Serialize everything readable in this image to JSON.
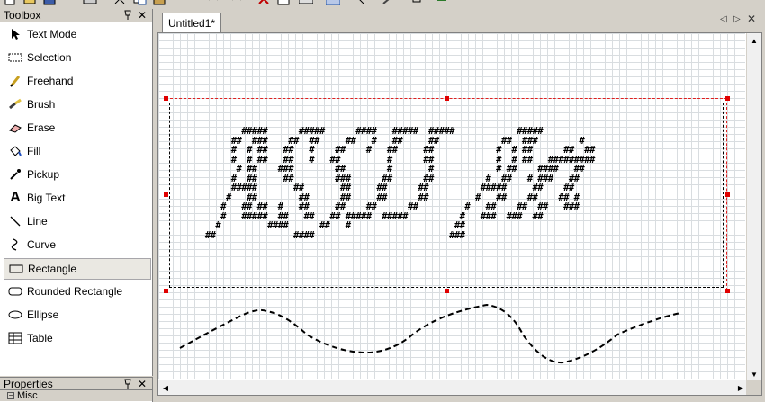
{
  "toolbar": {
    "icons": [
      "new-icon",
      "open-icon",
      "save-icon",
      "print-icon",
      "cut-icon",
      "copy-icon",
      "paste-icon",
      "undo-icon",
      "redo-icon",
      "delete-icon",
      "clipboard-icon",
      "keyboard-icon",
      "grid-icon",
      "pointer-icon",
      "wand-icon",
      "exit-icon"
    ]
  },
  "toolbox": {
    "title": "Toolbox",
    "pin_glyph": "📌",
    "close_glyph": "✕",
    "items": [
      {
        "label": "Text Mode",
        "icon": "arrow-cursor-icon"
      },
      {
        "label": "Selection",
        "icon": "selection-icon"
      },
      {
        "label": "Freehand",
        "icon": "pencil-icon"
      },
      {
        "label": "Brush",
        "icon": "brush-icon"
      },
      {
        "label": "Erase",
        "icon": "eraser-icon"
      },
      {
        "label": "Fill",
        "icon": "fill-bucket-icon"
      },
      {
        "label": "Pickup",
        "icon": "eyedropper-icon"
      },
      {
        "label": "Big Text",
        "icon": "big-a-icon"
      },
      {
        "label": "Line",
        "icon": "line-icon"
      },
      {
        "label": "Curve",
        "icon": "curve-icon"
      },
      {
        "label": "Rectangle",
        "icon": "rectangle-icon"
      },
      {
        "label": "Rounded Rectangle",
        "icon": "rounded-rectangle-icon"
      },
      {
        "label": "Ellipse",
        "icon": "ellipse-icon"
      },
      {
        "label": "Table",
        "icon": "table-icon"
      }
    ],
    "selected": "Rectangle"
  },
  "properties": {
    "title": "Properties",
    "misc_label": "Misc",
    "misc_toggle": "−"
  },
  "document": {
    "tab_label": "Untitled1*",
    "nav_prev": "◁",
    "nav_next": "▷",
    "nav_close": "✕",
    "ascii_lines": [
      "            #####      #####      ####   #####  #####            #####",
      "          ##  ###    ##  ##     ##   #   ##     ##            ##  ###        #",
      "          #  # ##   ##   #    ##    #   ##     ##            #  # ##      ##  ##",
      "          #  # ##   ##   #   ##         #      ##            #  # ##   #########",
      "           # ##    ###        ##        #       #            # ##    ####   ##",
      "          #  ##     ##        ###      ##      ##          #  ##   # ###   ##",
      "          #####       ##       ##     ##      ##          #####     ##    ##",
      "         #   ##        ##      ##     ##      ##         #   ##    ##    ## #",
      "        #   ## ##  #   ##     ##    ##      ##         #   ##    ##  ##   ###",
      "        #   #####  ##   ##   ## #####  #####          #   ###  ###  ##",
      "       #         ####      ##   #                    ##",
      "     ##               ####                          ###"
    ]
  },
  "colors": {
    "grid_line": "#d9dde0",
    "selection_border": "#e02020",
    "handle": "#e00000",
    "chrome": "#d4d0c8"
  }
}
